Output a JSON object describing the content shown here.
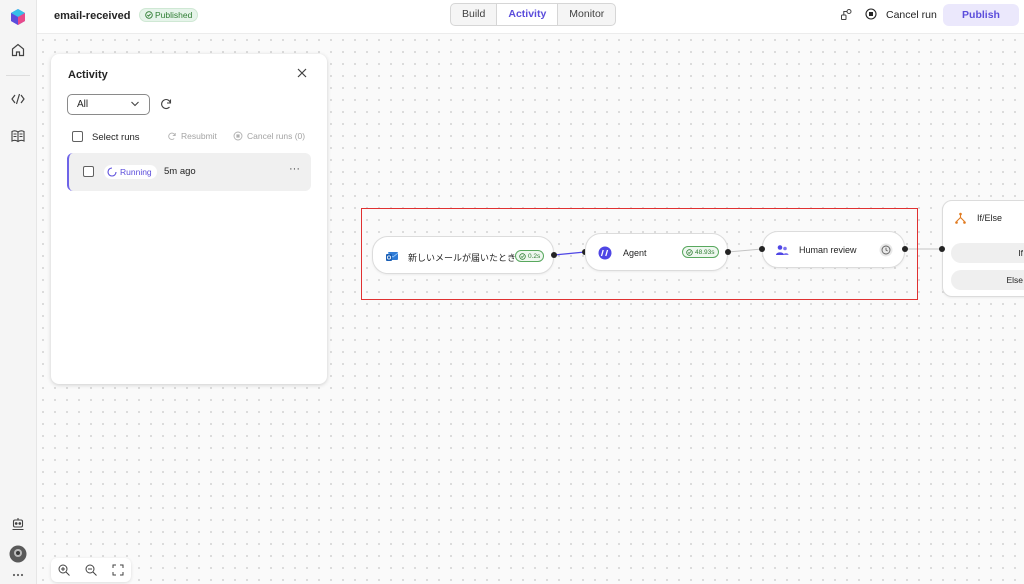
{
  "header": {
    "title": "email-received",
    "status": "Published",
    "tabs": [
      {
        "label": "Build"
      },
      {
        "label": "Activity"
      },
      {
        "label": "Monitor"
      }
    ],
    "active_tab": "Activity",
    "cancel_run_label": "Cancel run",
    "publish_label": "Publish"
  },
  "activity_panel": {
    "title": "Activity",
    "filter_value": "All",
    "select_runs_label": "Select runs",
    "resubmit_label": "Resubmit",
    "cancel_runs_label": "Cancel runs (0)",
    "runs": [
      {
        "status": "Running",
        "time": "5m ago",
        "more": "···"
      }
    ]
  },
  "flow": {
    "nodes": [
      {
        "label": "新しいメールが届いたとき",
        "duration": "0.2s"
      },
      {
        "label": "Agent",
        "duration": "48.93s"
      },
      {
        "label": "Human review"
      }
    ],
    "ifelse": {
      "label": "If/Else",
      "branches": [
        "If",
        "Else"
      ]
    }
  },
  "colors": {
    "accent": "#5b4ddb",
    "success": "#2e7d32",
    "highlight": "#e03131"
  },
  "icons": {
    "rail": [
      "app-logo-icon",
      "home-icon",
      "code-icon",
      "library-icon",
      "robot-icon",
      "avatar"
    ],
    "toolbar": [
      "flow-settings-icon",
      "stop-icon"
    ]
  }
}
